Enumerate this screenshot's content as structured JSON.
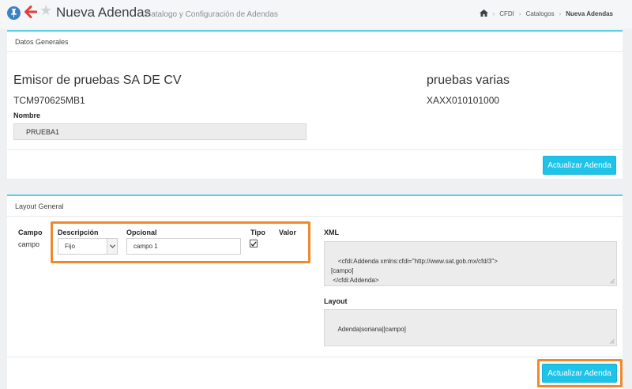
{
  "header": {
    "title": "Nueva Adendas",
    "subtitle": "Catalogo y Configuración de Adendas",
    "breadcrumb": [
      "CFDI",
      "Catalogos",
      "Nueva Adendas"
    ]
  },
  "datos_generales": {
    "heading": "Datos Generales",
    "emisor_name": "Emisor de pruebas SA DE CV",
    "emisor_rfc": "TCM970625MB1",
    "receptor_name": "pruebas varias",
    "receptor_rfc": "XAXX010101000",
    "nombre_label": "Nombre",
    "nombre_value": "PRUEBA1",
    "update_button": "Actualizar Adenda"
  },
  "layout_general": {
    "heading": "Layout General",
    "columns": {
      "campo": "Campo",
      "descripcion": "Descripción",
      "opcional": "Opcional",
      "tipo": "Tipo",
      "valor": "Valor"
    },
    "row": {
      "campo": "campo",
      "descripcion_selected": "Fijo",
      "opcional_value": "campo 1",
      "tipo_checked": true
    },
    "xml_label": "XML",
    "xml_value": "<cfdi:Addenda xmlns:cfdi=\"http://www.sat.gob.mx/cfd/3\">\n[campo]\n </cfdi:Addenda>",
    "layout_label": "Layout",
    "layout_value": "Adenda|soriana|[campo]",
    "update_button": "Actualizar Adenda"
  },
  "colors": {
    "accent": "#1ec3ea",
    "highlight": "#f0882e",
    "panel_border": "#5ad0e6",
    "back_arrow": "#e0403a",
    "pin": "#3b82c4"
  }
}
